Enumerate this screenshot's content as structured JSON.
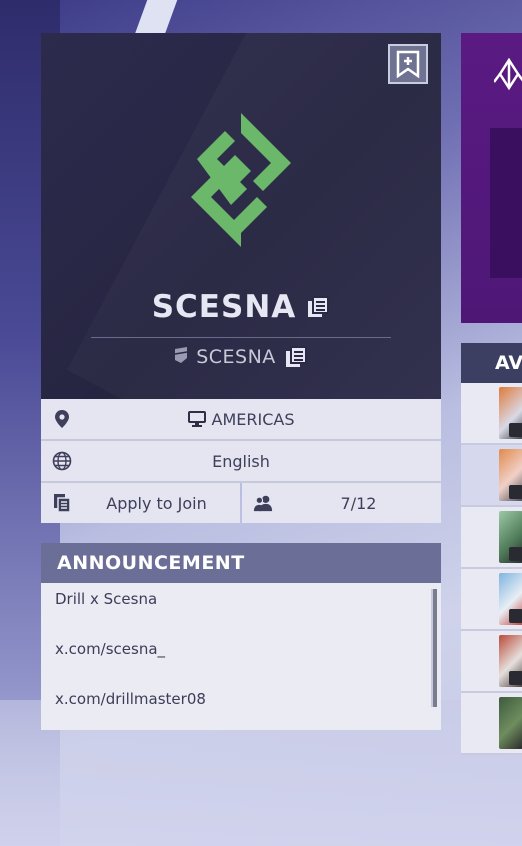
{
  "clan": {
    "name": "SCESNA",
    "tag": "SCESNA",
    "logo_color": "#6bb86b"
  },
  "info": {
    "region": "AMERICAS",
    "language": "English",
    "join_label": "Apply to Join",
    "members": "7/12"
  },
  "announcement": {
    "title": "ANNOUNCEMENT",
    "lines": [
      "Drill x Scesna",
      "x.com/scesna_",
      "x.com/drillmaster08"
    ]
  },
  "side_panel": {
    "section_title": "AVA"
  },
  "colors": {
    "card_bg": "#2a2946",
    "info_bg": "#e4e5f1",
    "header_bg": "#6b6e96"
  }
}
